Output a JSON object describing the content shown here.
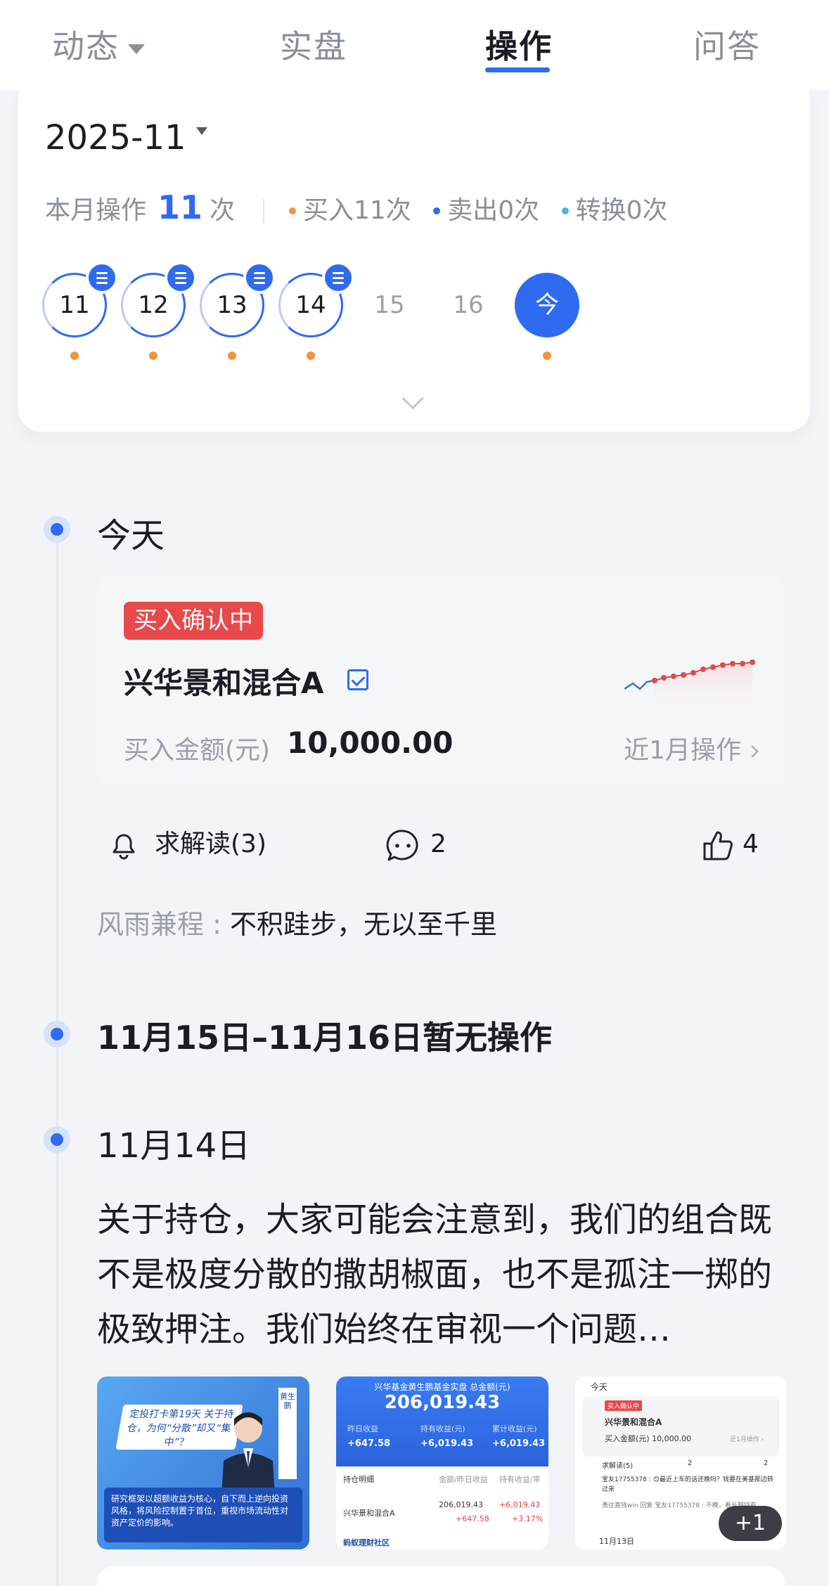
{
  "tabs": [
    {
      "label": "动态",
      "dropdown": true
    },
    {
      "label": "实盘"
    },
    {
      "label": "操作",
      "active": true
    },
    {
      "label": "问答"
    }
  ],
  "month": {
    "label": "2025-11",
    "summary_prefix": "本月操作",
    "count": "11",
    "summary_suffix": "次",
    "buy": "买入11次",
    "sell": "卖出0次",
    "convert": "转换0次",
    "colors": {
      "buy": "#f0953a",
      "sell": "#2e6bf0",
      "convert": "#4fb3e8"
    }
  },
  "days": [
    {
      "label": "11",
      "has_note": true,
      "has_op": true
    },
    {
      "label": "12",
      "has_note": true,
      "has_op": true
    },
    {
      "label": "13",
      "has_note": true,
      "has_op": true
    },
    {
      "label": "14",
      "has_note": true,
      "has_op": true
    },
    {
      "label": "15",
      "has_note": false,
      "has_op": false
    },
    {
      "label": "16",
      "has_note": false,
      "has_op": false
    },
    {
      "label": "今",
      "today": true,
      "has_op": true
    }
  ],
  "timeline": {
    "today": {
      "title": "今天",
      "status_tag": "买入确认中",
      "fund_name": "兴华景和混合A",
      "amount_label": "买入金额(元)",
      "amount_value": "10,000.00",
      "recent_link": "近1月操作",
      "actions": {
        "interpret": "求解读(3)",
        "comments": "2",
        "likes": "4"
      },
      "comment": {
        "author": "风雨兼程 :",
        "text": "不积跬步，无以至千里"
      }
    },
    "gap": {
      "title": "11月15日–11月16日暂无操作"
    },
    "nov14": {
      "title": "11月14日",
      "text": "关于持仓，大家可能会注意到，我们的组合既不是极度分散的撒胡椒面，也不是孤注一掷的极致押注。我们始终在审视一个问题…",
      "more_images": "+1"
    }
  },
  "thumb1": {
    "banner": "定投打卡第19天 关于持仓，为何“分散”却又“集中”？",
    "side": "黄生鹏",
    "quote": "研究框架以超额收益为核心，自下而上逆向投资风格，将风险控制置于首位，重视市场流动性对资产定价的影响。"
  },
  "thumb2": {
    "caption": "兴华基金黄生鹏基金实盘 总金额(元)",
    "total": "206,019.43",
    "labels": [
      "昨日收益",
      "持有收益(元)",
      "累计收益(元)"
    ],
    "values": [
      "+647.58",
      "+6,019.43",
      "+6,019.43"
    ],
    "row_header": [
      "持仓明细",
      "金额/昨日收益",
      "持有收益/率"
    ],
    "row": {
      "name": "兴华景和混合A",
      "amount": "206,019.43",
      "yday": "+647.58",
      "hold": "+6,019.43",
      "rate": "+3.17%"
    },
    "footer": "蚂蚁理财社区"
  },
  "thumb3": {
    "today": "今天",
    "tag": "买入确认中",
    "fund": "兴华景和混合A",
    "amount": "买入金额(元) 10,000.00",
    "recent": "近1月操作 ›",
    "actions": "求解读(5)",
    "comments": "2",
    "likes": "2",
    "c1": "宝友17755378 : 😊最近上车的话还晚吗？钱要在美基那边转过来",
    "c2": "勇往直钱win 回复 宝友17755378 : 不晚，看长期持有",
    "date": "11月13日"
  }
}
